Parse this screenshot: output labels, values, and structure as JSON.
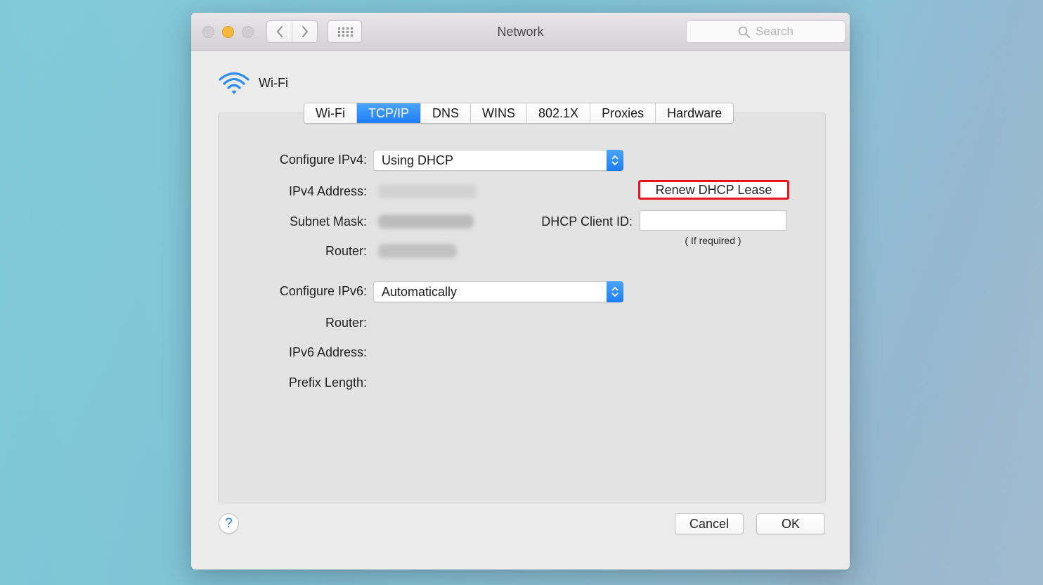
{
  "window": {
    "title": "Network"
  },
  "search": {
    "placeholder": "Search"
  },
  "header": {
    "service_name": "Wi-Fi"
  },
  "tabs": [
    {
      "label": "Wi-Fi",
      "active": false
    },
    {
      "label": "TCP/IP",
      "active": true
    },
    {
      "label": "DNS",
      "active": false
    },
    {
      "label": "WINS",
      "active": false
    },
    {
      "label": "802.1X",
      "active": false
    },
    {
      "label": "Proxies",
      "active": false
    },
    {
      "label": "Hardware",
      "active": false
    }
  ],
  "ipv4": {
    "configure_label": "Configure IPv4:",
    "configure_value": "Using DHCP",
    "address_label": "IPv4 Address:",
    "subnet_label": "Subnet Mask:",
    "router_label": "Router:"
  },
  "dhcp": {
    "renew_label": "Renew DHCP Lease",
    "client_id_label": "DHCP Client ID:",
    "client_id_value": "",
    "client_id_hint": "( If required )"
  },
  "ipv6": {
    "configure_label": "Configure IPv6:",
    "configure_value": "Automatically",
    "router_label": "Router:",
    "address_label": "IPv6 Address:",
    "prefix_label": "Prefix Length:"
  },
  "footer": {
    "help_label": "?",
    "cancel_label": "Cancel",
    "ok_label": "OK"
  },
  "colors": {
    "accent": "#1f7ef7",
    "highlight_border": "#e8141c",
    "minimize": "#f6b73a"
  },
  "icons": {
    "service": "wifi-icon",
    "search": "search-icon",
    "back": "chevron-left-icon",
    "forward": "chevron-right-icon",
    "grid": "grid-icon",
    "stepper": "up-down-chevron-icon"
  }
}
